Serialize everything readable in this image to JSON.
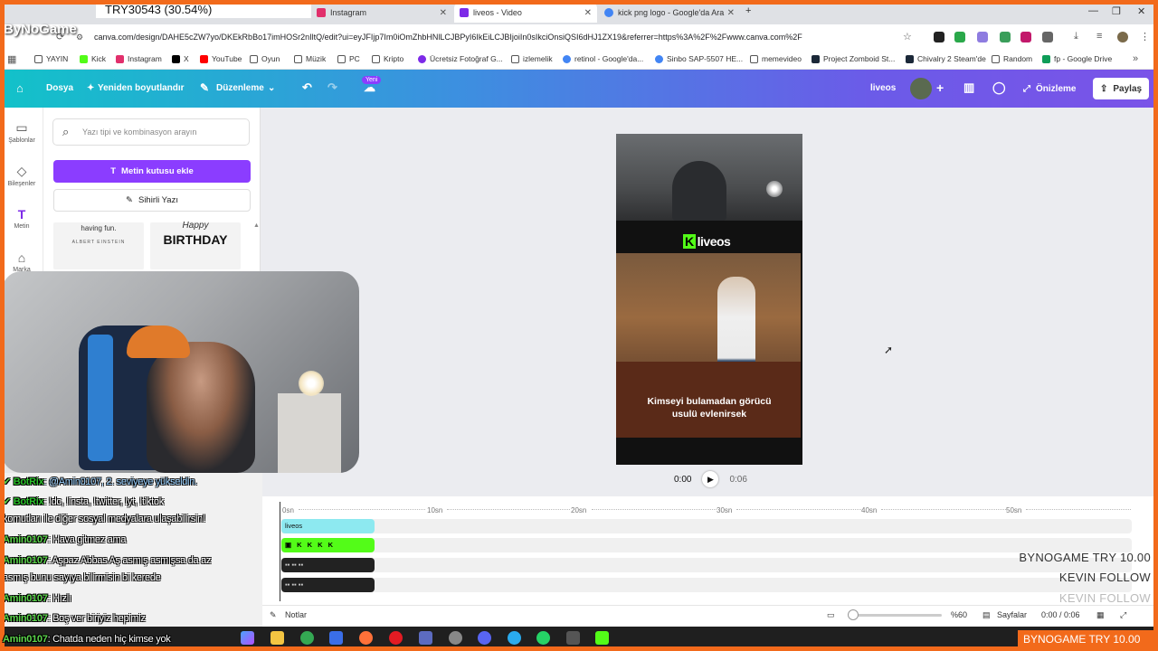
{
  "browser": {
    "price_chip": "TRY30543 (30.54%)",
    "tabs": [
      {
        "label": "Instagram"
      },
      {
        "label": "liveos - Video"
      },
      {
        "label": "kick png logo - Google'da Ara"
      }
    ],
    "url": "canva.com/design/DAHE5cZW7yo/DKEkRbBo17imHOSr2nIltQ/edit?ui=eyJFIjp7Im0iOmZhbHNlLCJBPyI6IkEiLCJBIjoiIn0sIkciOnsiQSI6dHJ1ZX19&referrer=https%3A%2F%2Fwww.canva.com%2F",
    "bookmarks": [
      "YAYIN",
      "Kick",
      "Instagram",
      "X",
      "YouTube",
      "Oyun",
      "Müzik",
      "PC",
      "Kripto",
      "Ücretsiz Fotoğraf G...",
      "izlemelik",
      "retinol - Google'da...",
      "Sinbo SAP-5507 HE...",
      "memevideo",
      "Project Zomboid St...",
      "Chivalry 2 Steam'de",
      "Random",
      "fp - Google Drive"
    ]
  },
  "canva": {
    "menu": {
      "file": "Dosya",
      "resize": "Yeniden boyutlandır",
      "edit": "Düzenleme",
      "new_badge": "Yeni"
    },
    "design_name": "liveos",
    "preview": "Önizleme",
    "share": "Paylaş",
    "rail": [
      "Şablonlar",
      "Bileşenler",
      "Metin",
      "Marka"
    ],
    "search_placeholder": "Yazı tipi ve kombinasyon arayın",
    "add_textbox": "Metin kutusu ekle",
    "magic_write": "Sihirli Yazı",
    "tile_quote": "having fun.",
    "tile_author": "ALBERT EINSTEIN",
    "tile_birthday_top": "Happy",
    "tile_birthday": "BIRTHDAY",
    "kick_brand": "liveos",
    "caption_line1": "Kimseyi bulamadan görücü",
    "caption_line2": "usulü evlenirsek",
    "time_current": "0:00",
    "time_total": "0:06",
    "timeline_ticks": [
      "0sn",
      "10sn",
      "20sn",
      "30sn",
      "40sn",
      "50sn"
    ],
    "clip_text": "liveos",
    "notes": "Notlar",
    "zoom": "%60",
    "pages": "Sayfalar",
    "time_readout": "0:00 / 0:06"
  },
  "stream": {
    "logo": "ByNoGame",
    "overlay_1": "BYNOGAME  TRY 10.00",
    "overlay_2": "KEVIN  FOLLOW",
    "overlay_3": "KEVIN  FOLLOW",
    "banner": "BYNOGAME  TRY 10.00"
  },
  "chat": [
    {
      "user": "BotRix",
      "msg": ": @Amin0107, 2. seviyeye yükseldin."
    },
    {
      "user": "BotRix",
      "msg": ": !dc, !insta, !twitter, !yt, !tiktok"
    },
    {
      "user": "",
      "msg": "komutları ile diğer sosyal medyalara ulaşabilirsin!"
    },
    {
      "user": "Amin0107",
      "msg": ": Hava gitmez ama"
    },
    {
      "user": "Amin0107",
      "msg": ": Aşpaz Abbas Aş asmış asmışsa da az"
    },
    {
      "user": "",
      "msg": "asmış bunu sayıya bilirmisin bi kerede"
    },
    {
      "user": "Amin0107",
      "msg": ": Hızlı"
    },
    {
      "user": "Amin0107",
      "msg": ": Boş ver biriyiz hepimiz"
    },
    {
      "user": "Amin0107",
      "msg": ": Chatda neden hiç kimse yok"
    }
  ]
}
